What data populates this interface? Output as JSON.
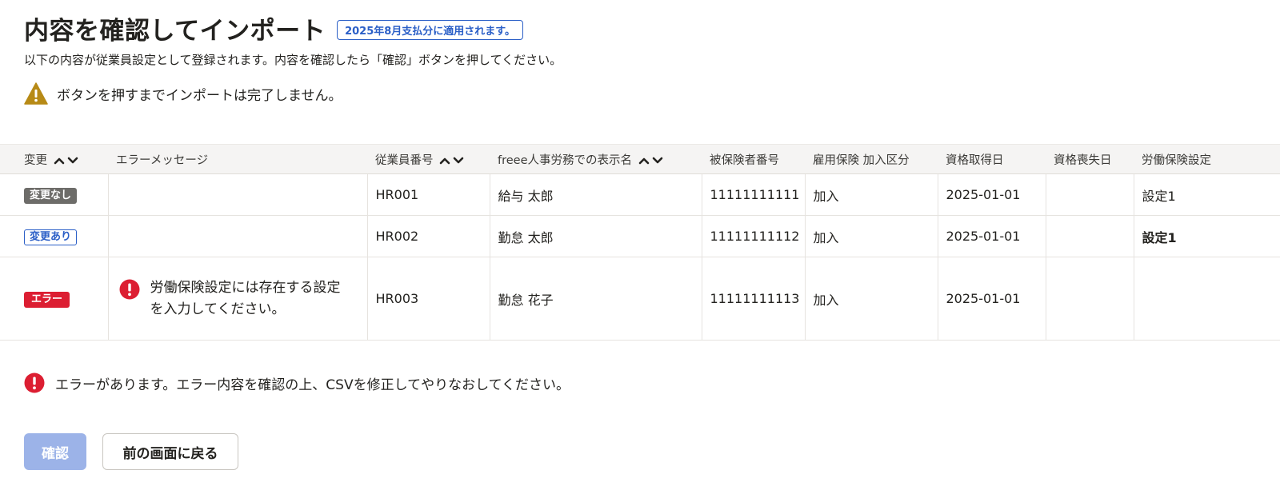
{
  "header": {
    "title": "内容を確認してインポート",
    "apply_badge": "2025年8月支払分に適用されます。",
    "description": "以下の内容が従業員設定として登録されます。内容を確認したら「確認」ボタンを押してください。"
  },
  "warning": {
    "icon": "warning-triangle-icon",
    "text": "ボタンを押すまでインポートは完了しません。",
    "color": "#b78a16"
  },
  "table": {
    "columns": [
      "変更",
      "エラーメッセージ",
      "従業員番号",
      "freee人事労務での表示名",
      "被保険者番号",
      "雇用保険 加入区分",
      "資格取得日",
      "資格喪失日",
      "労働保険設定"
    ],
    "rows": [
      {
        "status": "変更なし",
        "error_message": "",
        "employee_no": "HR001",
        "display_name": "給与 太郎",
        "insured_no": "11111111111",
        "employment_insurance": "加入",
        "acquired_date": "2025-01-01",
        "lost_date": "",
        "labor_insurance": "設定1"
      },
      {
        "status": "変更あり",
        "error_message": "",
        "employee_no": "HR002",
        "display_name": "勤怠 太郎",
        "insured_no": "11111111112",
        "employment_insurance": "加入",
        "acquired_date": "2025-01-01",
        "lost_date": "",
        "labor_insurance": "設定1"
      },
      {
        "status": "エラー",
        "error_message": "労働保険設定には存在する設定を入力してください。",
        "employee_no": "HR003",
        "display_name": "勤怠 花子",
        "insured_no": "11111111113",
        "employment_insurance": "加入",
        "acquired_date": "2025-01-01",
        "lost_date": "",
        "labor_insurance": ""
      }
    ]
  },
  "bottom_error": {
    "icon": "error-circle-icon",
    "text": "エラーがあります。エラー内容を確認の上、CSVを修正してやりなおしてください。",
    "color": "#dc1e32"
  },
  "buttons": {
    "confirm_label": "確認",
    "back_label": "前の画面に戻る"
  },
  "colors": {
    "accent": "#2b5fc7",
    "confirm_disabled": "#9cb3e8",
    "error": "#dc1e32",
    "no_change": "#6d6c69"
  }
}
